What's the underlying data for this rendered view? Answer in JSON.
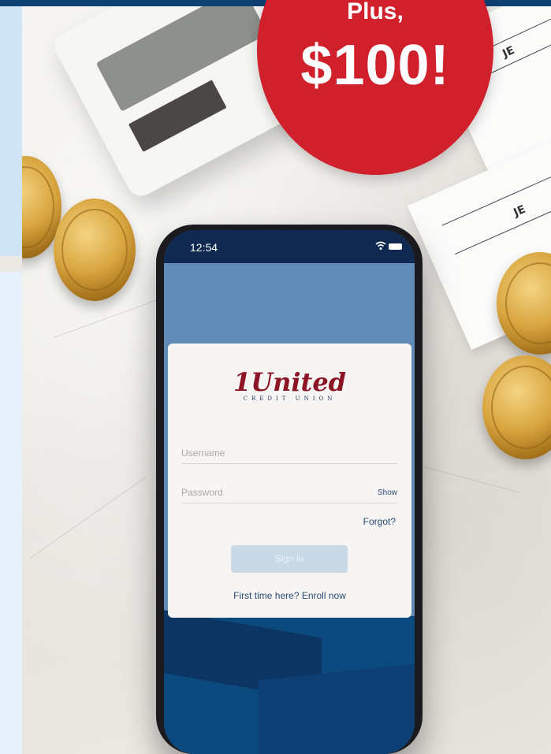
{
  "promo": {
    "plus_text": "Plus,",
    "amount": "$100!",
    "color": "#d0202c"
  },
  "phone": {
    "status_bar": {
      "time": "12:54",
      "icons": [
        "wifi-icon",
        "battery-icon"
      ]
    },
    "login": {
      "logo_wordmark": "United",
      "logo_numeral": "1",
      "logo_subtitle": "CREDIT UNION",
      "username_placeholder": "Username",
      "password_placeholder": "Password",
      "show_label": "Show",
      "forgot_label": "Forgot?",
      "signin_label": "Sign in",
      "enroll_label": "First time here? Enroll now"
    }
  },
  "photo": {
    "paper_text": "JE",
    "paper_text_2": "JE"
  },
  "colors": {
    "brand_navy": "#0e3f73",
    "logo_red": "#8b1524",
    "link_blue": "#2c4a76",
    "button_disabled": "#c8d9e7"
  }
}
